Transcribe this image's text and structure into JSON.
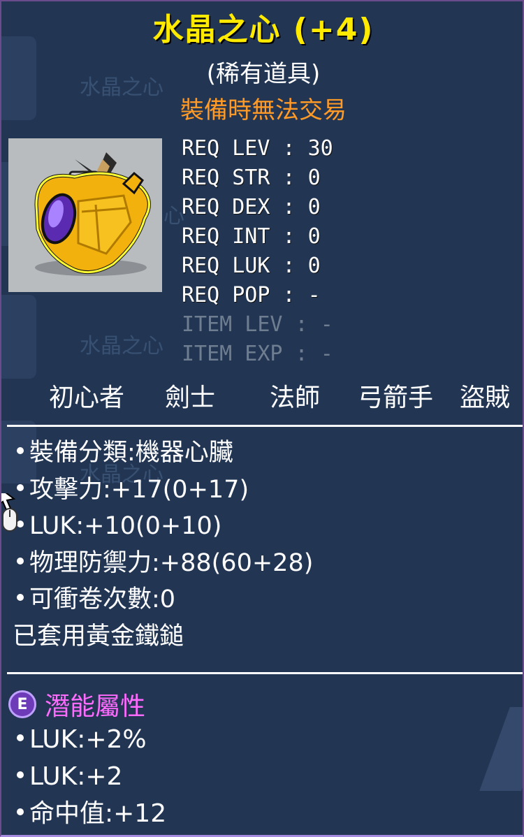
{
  "item": {
    "title": "水晶之心 (+4)",
    "rarity": "(稀有道具)",
    "untradable": "裝備時無法交易",
    "icon": "crystal-heart-icon"
  },
  "ghost": {
    "label_1": "水晶之心",
    "label_2": "水晶之心",
    "label_3": "水晶之心",
    "label_4": "心",
    "label_5": "水晶之心"
  },
  "requirements": [
    {
      "label": "REQ LEV",
      "value": "30"
    },
    {
      "label": "REQ STR",
      "value": "0"
    },
    {
      "label": "REQ DEX",
      "value": "0"
    },
    {
      "label": "REQ INT",
      "value": "0"
    },
    {
      "label": "REQ LUK",
      "value": "0"
    },
    {
      "label": "REQ POP",
      "value": "-"
    },
    {
      "label": "ITEM LEV",
      "value": "-"
    },
    {
      "label": "ITEM EXP",
      "value": "-"
    }
  ],
  "jobs": [
    "初心者",
    "劍士",
    "法師",
    "弓箭手",
    "盜賊"
  ],
  "stats": [
    "裝備分類:機器心臟",
    "攻擊力:+17(0+17)",
    "LUK:+10(0+10)",
    "物理防禦力:+88(60+28)",
    "可衝卷次數:0"
  ],
  "applied_note": "已套用黃金鐵鎚",
  "potential": {
    "badge": "E",
    "title": "潛能屬性",
    "lines": [
      "LUK:+2%",
      "LUK:+2",
      "命中值:+12"
    ]
  },
  "colors": {
    "background": "#223654",
    "title": "#ffea00",
    "untradable": "#ff9a26",
    "potential": "#ff6bff",
    "dim": "#6f7d90"
  }
}
